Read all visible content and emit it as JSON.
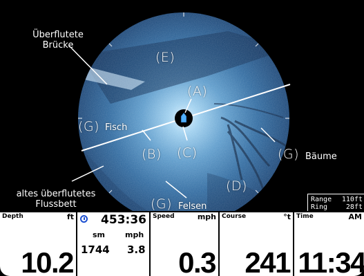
{
  "sonar": {
    "labels": {
      "ueberflutete": "Überflutete",
      "bruecke": "Brücke",
      "E": "(E)",
      "A": "(A)",
      "G_fisch": "(G)",
      "fisch": "Fisch",
      "B": "(B)",
      "C": "(C)",
      "G_baeume": "(G)",
      "baeume": "Bäume",
      "altes": "altes überflutetes",
      "flussbett": "Flussbett",
      "D": "(D)",
      "G_felsen": "(G)",
      "felsen": "Felsen"
    },
    "colors": {
      "sonar_bright": "#a9d7f5",
      "sonar_dark": "#0c2a4a",
      "boat": "#4fb0ff"
    }
  },
  "range_box": {
    "range_label": "Range",
    "range_value": "110ft",
    "ring_label": "Ring",
    "ring_value": "28ft"
  },
  "databar": {
    "depth": {
      "title": "Depth",
      "unit": "ft",
      "value": "10.2"
    },
    "timer": {
      "icon": "stopwatch-icon",
      "time": "453:36",
      "unit1": "sm",
      "unit2": "mph",
      "value1": "1744",
      "value2": "3.8"
    },
    "speed": {
      "title": "Speed",
      "unit": "mph",
      "value": "0.3"
    },
    "course": {
      "title": "Course",
      "unit": "°t",
      "value": "241"
    },
    "clock": {
      "title": "Time",
      "unit": "AM",
      "value": "11:34"
    }
  }
}
